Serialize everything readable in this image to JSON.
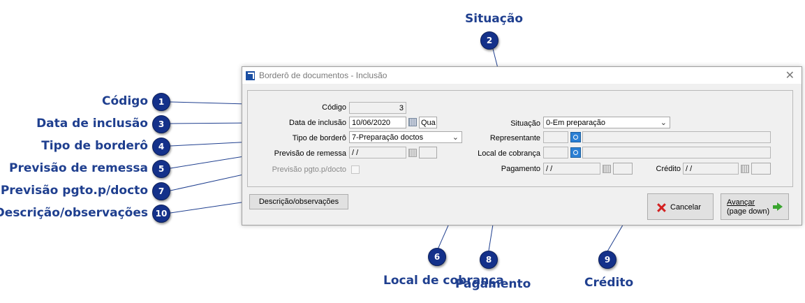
{
  "callouts": {
    "c1": {
      "label": "Código",
      "num": "1"
    },
    "c2": {
      "label": "Situação",
      "num": "2"
    },
    "c3": {
      "label": "Data de inclusão",
      "num": "3"
    },
    "c4": {
      "label": "Tipo de borderô",
      "num": "4"
    },
    "c5": {
      "label": "Previsão de remessa",
      "num": "5"
    },
    "c6": {
      "label": "Local de cobrança",
      "num": "6"
    },
    "c7": {
      "label": "Previsão pgto.p/docto",
      "num": "7"
    },
    "c8": {
      "label": "Pagamento",
      "num": "8"
    },
    "c9": {
      "label": "Crédito",
      "num": "9"
    },
    "c10": {
      "label": "Descrição/observações",
      "num": "10"
    }
  },
  "window": {
    "title": "Borderô de documentos - Inclusão",
    "close_glyph": "✕"
  },
  "form": {
    "codigo": {
      "label": "Código",
      "value": "3"
    },
    "data_inclusao": {
      "label": "Data de inclusão",
      "value": "10/06/2020",
      "weekday": "Qua"
    },
    "tipo_bordero": {
      "label": "Tipo de borderô",
      "value": "7-Preparação doctos"
    },
    "previsao_remessa": {
      "label": "Previsão de remessa",
      "value": " / /"
    },
    "previsao_pgto": {
      "label": "Previsão pgto.p/docto"
    },
    "situacao": {
      "label": "Situação",
      "value": "0-Em preparação"
    },
    "representante": {
      "label": "Representante",
      "value": ""
    },
    "local_cobranca": {
      "label": "Local de cobrança",
      "value": ""
    },
    "pagamento": {
      "label": "Pagamento",
      "value": " / /"
    },
    "credito": {
      "label": "Crédito",
      "value": " / /"
    }
  },
  "buttons": {
    "descricao": "Descrição/observações",
    "cancelar": "Cancelar",
    "avancar_line1": "Avançar",
    "avancar_line2": "(page down)"
  },
  "colors": {
    "badge": "#14318a",
    "callout_text": "#1f3f8f"
  },
  "icons": {
    "calendar": "calendar-icon",
    "lookup": "lookup-icon",
    "cancel": "cancel-x-icon",
    "next": "green-arrow-icon"
  }
}
